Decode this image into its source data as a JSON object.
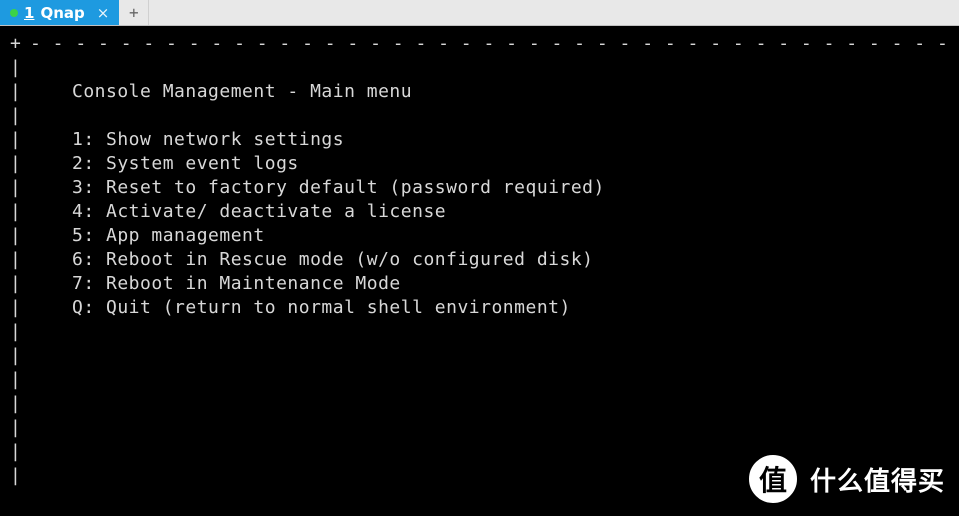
{
  "tabbar": {
    "tabs": [
      {
        "index": "1",
        "title": "Qnap",
        "active": true
      }
    ],
    "close_glyph": "×",
    "newtab_glyph": "+"
  },
  "terminal": {
    "border_top_left": "+",
    "border_vert": "|",
    "dash_row": "- - - - - - - - - - - - - - - - - - - - - - - - - - - - - - - - - - - - - - - - - - - - - - - - - - - - - - - - - - - - - - - - - - -",
    "title": "Console Management - Main menu",
    "menu": [
      {
        "key": "1",
        "label": "Show network settings"
      },
      {
        "key": "2",
        "label": "System event logs"
      },
      {
        "key": "3",
        "label": "Reset to factory default (password required)"
      },
      {
        "key": "4",
        "label": "Activate/ deactivate a license"
      },
      {
        "key": "5",
        "label": "App management"
      },
      {
        "key": "6",
        "label": "Reboot in Rescue mode (w/o configured disk)"
      },
      {
        "key": "7",
        "label": "Reboot in Maintenance Mode"
      },
      {
        "key": "Q",
        "label": "Quit (return to normal shell environment)"
      }
    ],
    "blank_trailing_rows": 7
  },
  "watermark": {
    "badge": "值",
    "text": "什么值得买"
  }
}
